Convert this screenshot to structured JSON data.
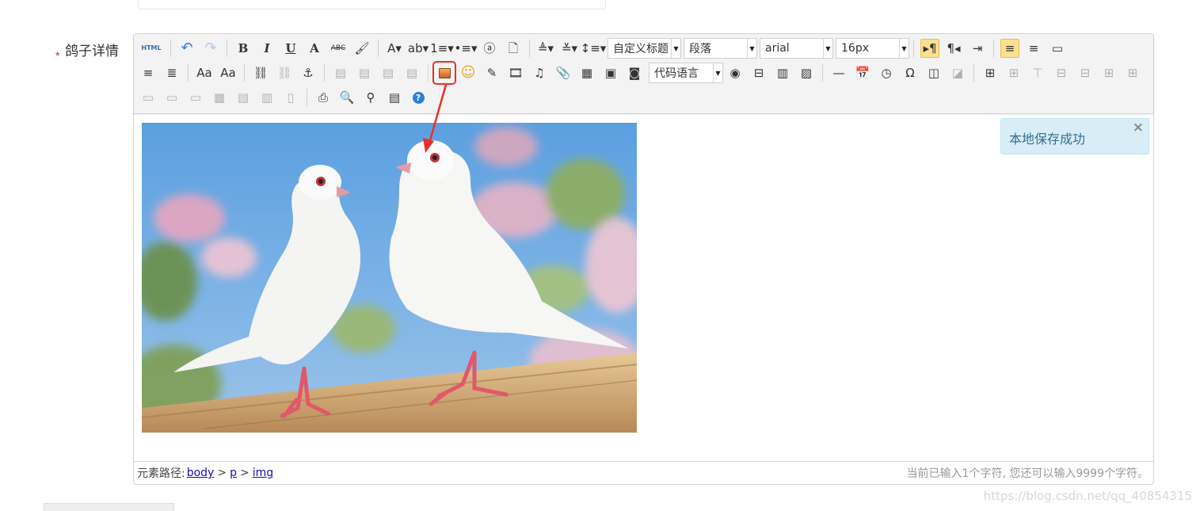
{
  "form": {
    "required_mark": "*",
    "label": "鸽子详情"
  },
  "toolbar": {
    "row1": [
      {
        "name": "source-html-button",
        "glyph": "HTML",
        "wide": true
      },
      "sep",
      {
        "name": "undo-icon",
        "glyph": "↶"
      },
      {
        "name": "redo-icon",
        "glyph": "↷",
        "faded": true
      },
      "sep",
      {
        "name": "bold-icon",
        "glyph": "B"
      },
      {
        "name": "italic-icon",
        "glyph": "I"
      },
      {
        "name": "underline-icon",
        "glyph": "U"
      },
      {
        "name": "font-border-icon",
        "glyph": "A"
      },
      {
        "name": "strikethrough-icon",
        "glyph": "ABC"
      },
      {
        "name": "format-brush-icon",
        "glyph": "🖌"
      },
      "sep",
      {
        "name": "font-color-icon",
        "glyph": "A▾"
      },
      {
        "name": "background-color-icon",
        "glyph": "ab▾"
      },
      {
        "name": "ordered-list-icon",
        "glyph": "1≡▾"
      },
      {
        "name": "unordered-list-icon",
        "glyph": "•≡▾"
      },
      {
        "name": "select-all-icon",
        "glyph": "ⓐ"
      },
      {
        "name": "clear-doc-icon",
        "glyph": "🗋"
      },
      "sep",
      {
        "name": "row-spacing-top-icon",
        "glyph": "≜▾"
      },
      {
        "name": "row-spacing-bottom-icon",
        "glyph": "≚▾"
      },
      {
        "name": "line-height-icon",
        "glyph": "↕≡▾"
      }
    ],
    "row1_combos": {
      "custom_title": "自定义标题",
      "paragraph": "段落",
      "font_family": "arial",
      "font_size": "16px"
    },
    "row1_after": [
      {
        "name": "ltr-direction-icon",
        "glyph": "▸¶",
        "active": true
      },
      {
        "name": "rtl-direction-icon",
        "glyph": "¶◂"
      },
      {
        "name": "indent-icon",
        "glyph": "⇥"
      },
      "sep",
      {
        "name": "justify-left-icon",
        "glyph": "≡",
        "active": true
      },
      {
        "name": "justify-center-icon",
        "glyph": "≡"
      },
      {
        "name": "fullscreen-icon",
        "glyph": "▭"
      }
    ],
    "row2": [
      {
        "name": "justify-right-icon",
        "glyph": "≡"
      },
      {
        "name": "justify-full-icon",
        "glyph": "≣"
      },
      "sep",
      {
        "name": "uppercase-icon",
        "glyph": "Aa"
      },
      {
        "name": "lowercase-icon",
        "glyph": "Aa"
      },
      "sep",
      {
        "name": "link-icon",
        "glyph": "⛓"
      },
      {
        "name": "unlink-icon",
        "glyph": "⛓",
        "faded": true
      },
      {
        "name": "anchor-icon",
        "glyph": "⚓"
      },
      "sep",
      {
        "name": "image-none-icon",
        "glyph": "▤",
        "faded": true
      },
      {
        "name": "image-left-icon",
        "glyph": "▤",
        "faded": true
      },
      {
        "name": "image-right-icon",
        "glyph": "▤",
        "faded": true
      },
      {
        "name": "image-center-icon",
        "glyph": "▤",
        "faded": true
      },
      "sep",
      {
        "name": "simple-upload-image-icon",
        "glyph": "img",
        "highlight": true
      },
      {
        "name": "emotion-icon",
        "glyph": "☺"
      },
      {
        "name": "scrawl-icon",
        "glyph": "✎"
      },
      {
        "name": "insert-video-icon",
        "glyph": "🎞"
      },
      {
        "name": "music-icon",
        "glyph": "♫"
      },
      {
        "name": "attachment-icon",
        "glyph": "📎"
      },
      {
        "name": "map-icon",
        "glyph": "▦"
      },
      {
        "name": "google-map-icon",
        "glyph": "▣"
      },
      {
        "name": "insert-frame-icon",
        "glyph": "◙"
      }
    ],
    "row2_combo": "代码语言",
    "row2_after": [
      {
        "name": "web-app-icon",
        "glyph": "◉"
      },
      {
        "name": "page-break-icon",
        "glyph": "⊟"
      },
      {
        "name": "template-icon",
        "glyph": "▥"
      },
      {
        "name": "background-icon",
        "glyph": "▨"
      },
      "sep",
      {
        "name": "horizontal-rule-icon",
        "glyph": "—"
      },
      {
        "name": "insert-date-icon",
        "glyph": "📅"
      },
      {
        "name": "insert-time-icon",
        "glyph": "◷"
      },
      {
        "name": "special-chars-icon",
        "glyph": "Ω"
      },
      {
        "name": "snapscreen-icon",
        "glyph": "◫"
      },
      {
        "name": "wordimage-icon",
        "glyph": "◪",
        "faded": true
      },
      "sep",
      {
        "name": "insert-table-icon",
        "glyph": "⊞"
      },
      {
        "name": "delete-table-icon",
        "glyph": "⊞",
        "faded": true
      },
      {
        "name": "insert-paragraph-before-table-icon",
        "glyph": "⊤",
        "faded": true
      },
      {
        "name": "insert-row-icon",
        "glyph": "⊟",
        "faded": true
      },
      {
        "name": "delete-row-icon",
        "glyph": "⊟",
        "faded": true
      },
      {
        "name": "insert-col-icon",
        "glyph": "⊞",
        "faded": true
      },
      {
        "name": "delete-col-icon",
        "glyph": "⊞",
        "faded": true
      }
    ],
    "row3": [
      {
        "name": "merge-cells-icon",
        "glyph": "▭",
        "faded": true
      },
      {
        "name": "merge-right-icon",
        "glyph": "▭",
        "faded": true
      },
      {
        "name": "merge-down-icon",
        "glyph": "▭",
        "faded": true
      },
      {
        "name": "split-to-cells-icon",
        "glyph": "▦",
        "faded": true
      },
      {
        "name": "split-to-rows-icon",
        "glyph": "▤",
        "faded": true
      },
      {
        "name": "split-to-cols-icon",
        "glyph": "▥",
        "faded": true
      },
      {
        "name": "chart-icon",
        "glyph": "▯",
        "faded": true
      },
      "sep",
      {
        "name": "print-icon",
        "glyph": "⎙"
      },
      {
        "name": "preview-icon",
        "glyph": "🔍"
      },
      {
        "name": "search-replace-icon",
        "glyph": "⚲"
      },
      {
        "name": "draft-icon",
        "glyph": "▤"
      },
      {
        "name": "help-icon",
        "glyph": "?"
      }
    ]
  },
  "notice": {
    "text": "本地保存成功",
    "close": "×"
  },
  "statusbar": {
    "path_label": "元素路径:",
    "path": [
      "body",
      "p",
      "img"
    ],
    "separator": ">",
    "count_text": "当前已输入1个字符, 您还可以输入9999个字符。"
  },
  "watermark": "https://blog.csdn.net/qq_40854315",
  "colors": {
    "accent_red": "#e8302a",
    "active_button": "#fcdf8f",
    "notice_bg": "#d9edf7",
    "notice_text": "#31708f"
  }
}
